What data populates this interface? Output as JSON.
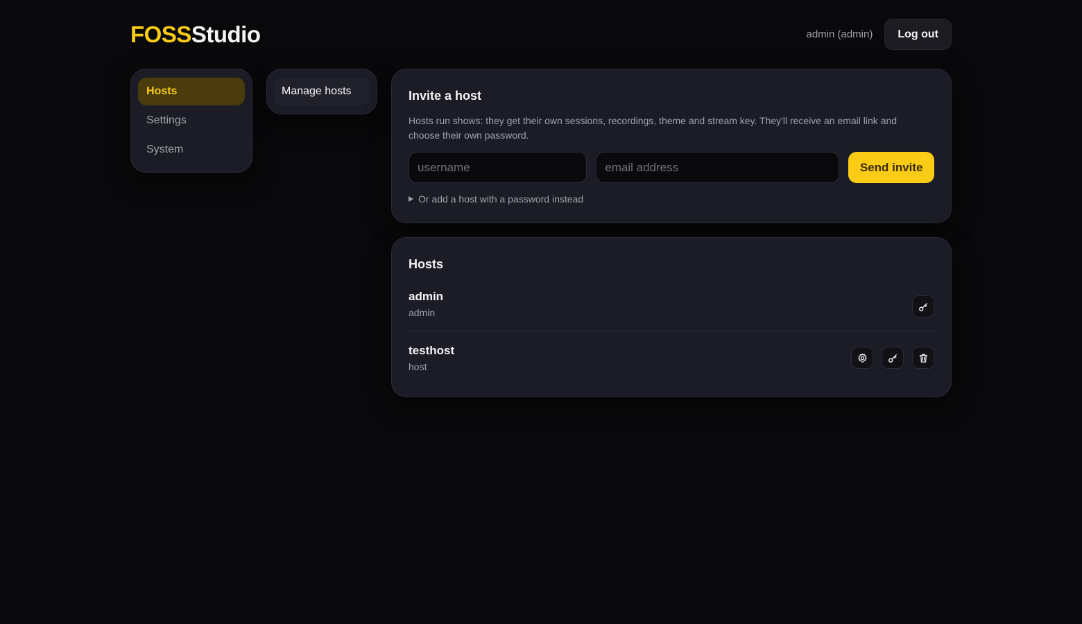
{
  "header": {
    "logo_accent": "FOSS",
    "logo_rest": "Studio",
    "user_label": "admin (admin)",
    "logout_label": "Log out"
  },
  "sidebar": {
    "items": [
      {
        "label": "Hosts",
        "active": true
      },
      {
        "label": "Settings",
        "active": false
      },
      {
        "label": "System",
        "active": false
      }
    ]
  },
  "subnav": {
    "items": [
      {
        "label": "Manage hosts",
        "active": true
      }
    ]
  },
  "invite": {
    "title": "Invite a host",
    "description": "Hosts run shows: they get their own sessions, recordings, theme and stream key. They'll receive an email link and choose their own password.",
    "username_placeholder": "username",
    "email_placeholder": "email address",
    "username_value": "",
    "email_value": "",
    "send_label": "Send invite",
    "password_toggle_label": "Or add a host with a password instead"
  },
  "hosts": {
    "title": "Hosts",
    "rows": [
      {
        "name": "admin",
        "role": "admin",
        "actions": [
          "key-icon"
        ]
      },
      {
        "name": "testhost",
        "role": "host",
        "actions": [
          "gear-icon",
          "key-icon",
          "trash-icon"
        ]
      }
    ]
  },
  "colors": {
    "accent": "#facc15",
    "background": "#09090b",
    "panel": "#1b1c26",
    "active_nav_bg": "#4a3c0c"
  }
}
